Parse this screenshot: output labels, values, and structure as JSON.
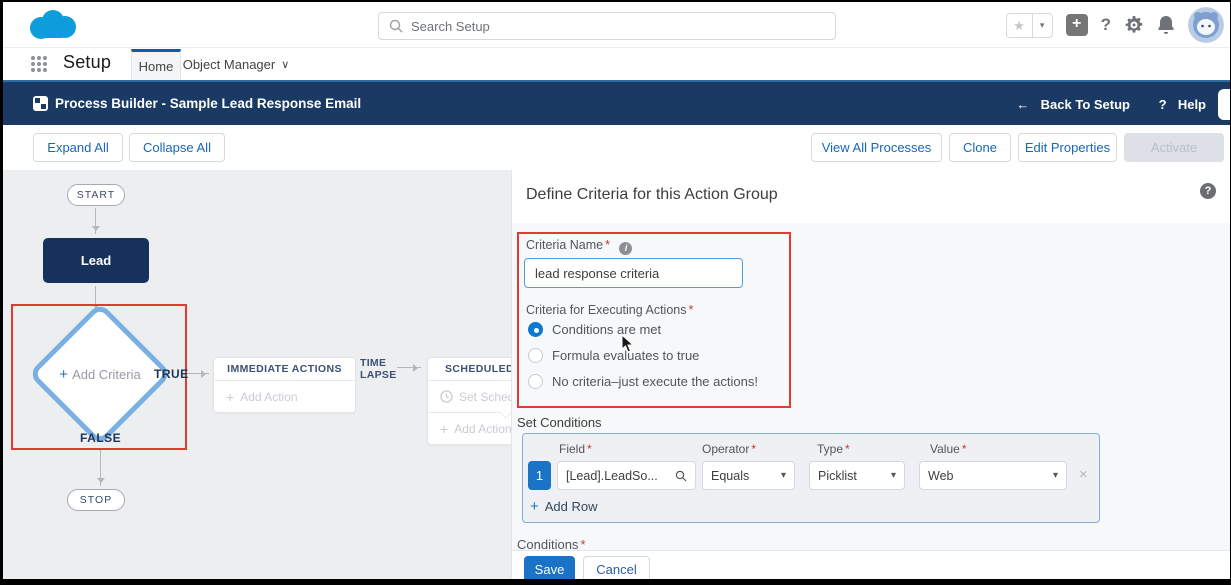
{
  "colors": {
    "accent_blue": "#0070d2",
    "navy": "#16325c",
    "header_bg": "#1b3a63",
    "diamond_border": "#79afe1",
    "highlight_red": "#dd3b34",
    "canvas_bg": "#edeef0"
  },
  "ui": {
    "required": "*",
    "plus": "+",
    "back_arrow": "←",
    "question": "?",
    "close": "×",
    "chevron_down": "▾",
    "chevron_tab": "∨",
    "star": "★",
    "info": "i"
  },
  "app": {
    "search_placeholder": "Search Setup",
    "setup_label": "Setup",
    "tab_home": "Home",
    "tab_object_manager": "Object Manager"
  },
  "builder_header": {
    "title": "Process Builder - Sample Lead Response Email",
    "back_link": "Back To Setup",
    "help_label": "Help"
  },
  "toolbar": {
    "expand_all": "Expand All",
    "collapse_all": "Collapse All",
    "view_all": "View All Processes",
    "clone": "Clone",
    "edit_properties": "Edit Properties",
    "activate": "Activate"
  },
  "canvas": {
    "start": "START",
    "object_node": "Lead",
    "add_criteria": "Add Criteria",
    "true_label": "TRUE",
    "false_label": "FALSE",
    "stop": "STOP",
    "immediate": {
      "title": "IMMEDIATE ACTIONS",
      "add_action": "Add Action"
    },
    "time_lapse_line1": "TIME",
    "time_lapse_line2": "LAPSE",
    "scheduled": {
      "title": "SCHEDULED ACTIONS",
      "set_schedule": "Set Schedule",
      "add_action": "Add Action"
    }
  },
  "panel": {
    "title": "Define Criteria for this Action Group",
    "criteria_name_label": "Criteria Name",
    "criteria_name_value": "lead response criteria",
    "executing_label": "Criteria for Executing Actions",
    "radios": [
      {
        "label": "Conditions are met",
        "selected": true
      },
      {
        "label": "Formula evaluates to true",
        "selected": false
      },
      {
        "label": "No criteria–just execute the actions!",
        "selected": false
      }
    ],
    "set_conditions_label": "Set Conditions",
    "conditions_table": {
      "headers": {
        "field": "Field",
        "operator": "Operator",
        "type": "Type",
        "value": "Value"
      },
      "rows": [
        {
          "num": "1",
          "field": "[Lead].LeadSo...",
          "operator": "Equals",
          "type": "Picklist",
          "value": "Web"
        }
      ],
      "add_row": "Add Row"
    },
    "conditions_label": "Conditions",
    "save": "Save",
    "cancel": "Cancel"
  }
}
